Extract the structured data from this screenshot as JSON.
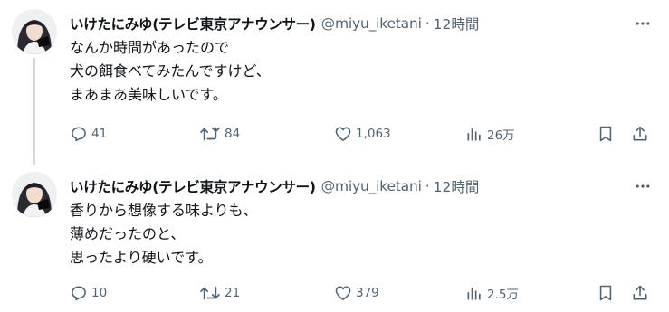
{
  "tweets": [
    {
      "author": {
        "name": "いけたにみゆ(テレビ東京アナウンサー)",
        "handle": "@miyu_iketani",
        "time": "12時間"
      },
      "lines": [
        "なんか時間があったので",
        "犬の餌食べてみたんですけど、",
        "まあまあ美味しいです。"
      ],
      "stats": {
        "replies": "41",
        "reposts": "84",
        "likes": "1,063",
        "views": "26万"
      }
    },
    {
      "author": {
        "name": "いけたにみゆ(テレビ東京アナウンサー)",
        "handle": "@miyu_iketani",
        "time": "12時間"
      },
      "lines": [
        "香りから想像する味よりも、",
        "薄めだったのと、",
        "思ったより硬いです。"
      ],
      "stats": {
        "replies": "10",
        "reposts": "21",
        "likes": "379",
        "views": "2.5万"
      }
    }
  ],
  "separator": "·",
  "colors": {
    "text": "#0f1419",
    "secondary": "#536471",
    "thread_line": "#cfd9de"
  },
  "icons": {
    "more": "more-icon",
    "reply": "reply-icon",
    "repost": "repost-icon",
    "like": "heart-icon",
    "views": "views-icon",
    "bookmark": "bookmark-icon",
    "share": "share-icon"
  }
}
